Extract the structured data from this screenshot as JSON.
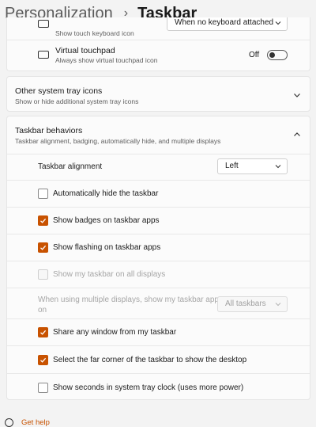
{
  "header": {
    "parent": "Personalization",
    "separator": "›",
    "current": "Taskbar"
  },
  "touch_keyboard": {
    "subtitle": "Show touch keyboard icon",
    "dropdown_value": "When no keyboard attached"
  },
  "virtual_touchpad": {
    "title": "Virtual touchpad",
    "subtitle": "Always show virtual touchpad icon",
    "toggle_label": "Off",
    "toggle_on": false,
    "icon": "touchpad-icon"
  },
  "other_tray": {
    "title": "Other system tray icons",
    "subtitle": "Show or hide additional system tray icons",
    "icon": "chevron-down-icon"
  },
  "behaviors": {
    "title": "Taskbar behaviors",
    "subtitle": "Taskbar alignment, badging, automatically hide, and multiple displays",
    "icon": "chevron-up-icon",
    "alignment_label": "Taskbar alignment",
    "alignment_value": "Left",
    "auto_hide": {
      "label": "Automatically hide the taskbar",
      "checked": false
    },
    "badges": {
      "label": "Show badges on taskbar apps",
      "checked": true
    },
    "flashing": {
      "label": "Show flashing on taskbar apps",
      "checked": true
    },
    "all_displays": {
      "label": "Show my taskbar on all displays",
      "checked": false,
      "disabled": true
    },
    "multi_display_label": "When using multiple displays, show my taskbar apps on",
    "multi_display_value": "All taskbars",
    "share_window": {
      "label": "Share any window from my taskbar",
      "checked": true
    },
    "far_corner": {
      "label": "Select the far corner of the taskbar to show the desktop",
      "checked": true
    },
    "seconds": {
      "label": "Show seconds in system tray clock (uses more power)",
      "checked": false
    }
  },
  "help": {
    "label": "Get help",
    "icon": "help-icon"
  },
  "colors": {
    "accent": "#c85200",
    "background": "#f3f3f3",
    "card": "#fbfbfb"
  }
}
